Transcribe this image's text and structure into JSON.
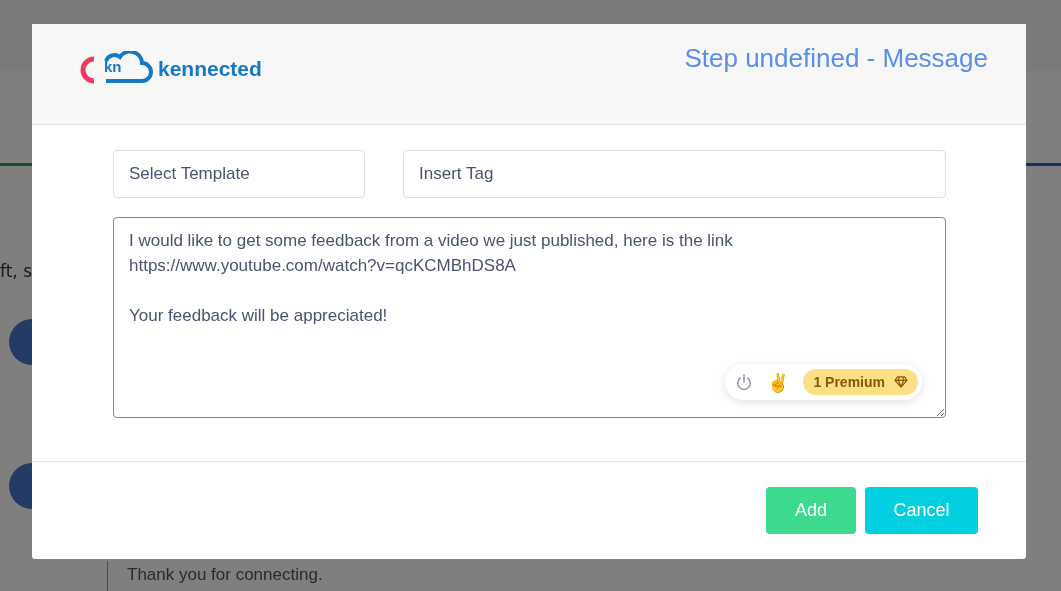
{
  "background_page": {
    "text_fragment": "ft, s",
    "message_preview": "Thank you for connecting."
  },
  "modal": {
    "logo": {
      "mark": "kn",
      "name": "kennected"
    },
    "title": "Step undefined - Message",
    "template_select": {
      "placeholder": "Select Template"
    },
    "tag_select": {
      "placeholder": "Insert Tag"
    },
    "message": {
      "value": "I would like to get some feedback from a video we just published, here is the link\nhttps://www.youtube.com/watch?v=qcKCMBhDS8A\n\nYour feedback will be appreciated!"
    },
    "message_tools": {
      "emoji": "✌️",
      "premium_badge": "1 Premium"
    },
    "buttons": [
      {
        "kind": "primary",
        "label": "Add"
      },
      {
        "kind": "secondary",
        "label": "Cancel"
      }
    ]
  }
}
